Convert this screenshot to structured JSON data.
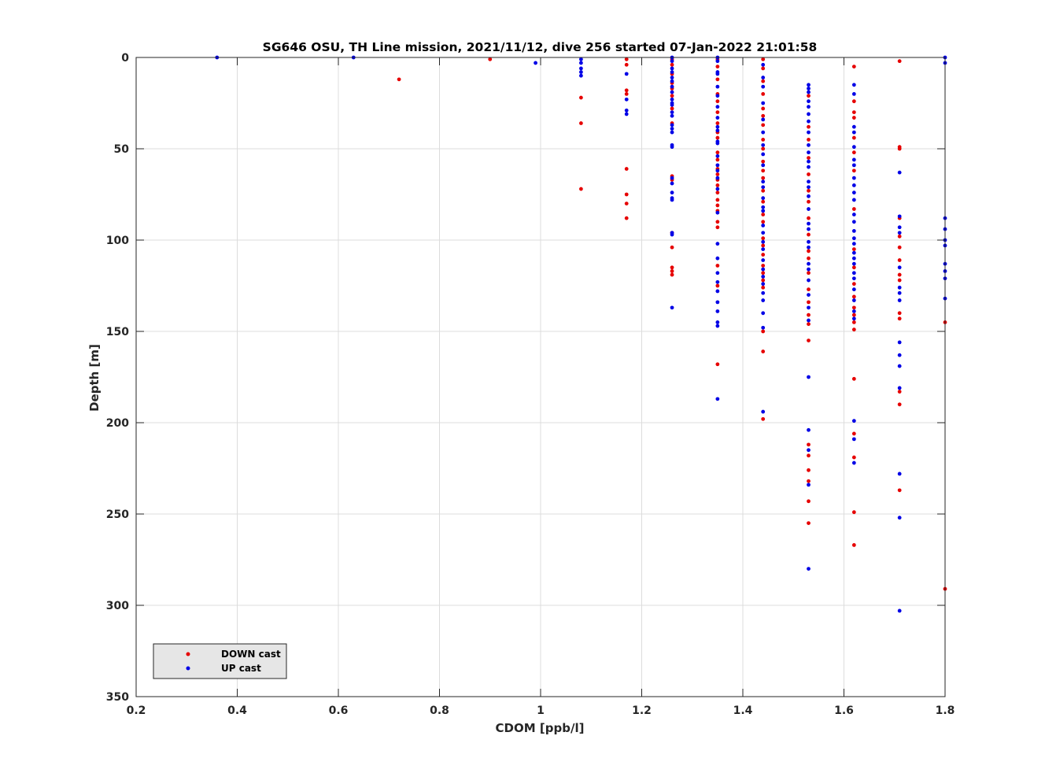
{
  "chart_data": {
    "type": "scatter",
    "title": "SG646 OSU, TH Line mission, 2021/11/12, dive 256 started 07-Jan-2022 21:01:58",
    "xlabel": "CDOM [ppb/l]",
    "ylabel": "Depth [m]",
    "xlim": [
      0.2,
      1.8
    ],
    "ylim": [
      0,
      350
    ],
    "y_reversed": true,
    "x_ticks": [
      0.2,
      0.4,
      0.6,
      0.8,
      1,
      1.2,
      1.4,
      1.6,
      1.8
    ],
    "x_tick_labels": [
      "0.2",
      "0.4",
      "0.6",
      "0.8",
      "1",
      "1.2",
      "1.4",
      "1.6",
      "1.8"
    ],
    "y_ticks": [
      0,
      50,
      100,
      150,
      200,
      250,
      300,
      350
    ],
    "y_tick_labels": [
      "0",
      "50",
      "100",
      "150",
      "200",
      "250",
      "300",
      "350"
    ],
    "grid": true,
    "legend_position": "bottom-left",
    "series": [
      {
        "name": "DOWN cast",
        "color": "#e60000",
        "points": [
          [
            0.72,
            12
          ],
          [
            0.9,
            1
          ],
          [
            1.08,
            22
          ],
          [
            1.08,
            36
          ],
          [
            1.08,
            72
          ],
          [
            1.17,
            1
          ],
          [
            1.17,
            4
          ],
          [
            1.17,
            18
          ],
          [
            1.17,
            20
          ],
          [
            1.17,
            61
          ],
          [
            1.17,
            75
          ],
          [
            1.17,
            80
          ],
          [
            1.17,
            88
          ],
          [
            1.26,
            1
          ],
          [
            1.26,
            4
          ],
          [
            1.26,
            9
          ],
          [
            1.26,
            14
          ],
          [
            1.26,
            17
          ],
          [
            1.26,
            21
          ],
          [
            1.26,
            28
          ],
          [
            1.26,
            36
          ],
          [
            1.26,
            65
          ],
          [
            1.26,
            67
          ],
          [
            1.26,
            96
          ],
          [
            1.26,
            104
          ],
          [
            1.26,
            115
          ],
          [
            1.26,
            117
          ],
          [
            1.26,
            119
          ],
          [
            1.35,
            1
          ],
          [
            1.35,
            5
          ],
          [
            1.35,
            12
          ],
          [
            1.35,
            20
          ],
          [
            1.35,
            24
          ],
          [
            1.35,
            30
          ],
          [
            1.35,
            36
          ],
          [
            1.35,
            41
          ],
          [
            1.35,
            44
          ],
          [
            1.35,
            52
          ],
          [
            1.35,
            56
          ],
          [
            1.35,
            61
          ],
          [
            1.35,
            64
          ],
          [
            1.35,
            67
          ],
          [
            1.35,
            70
          ],
          [
            1.35,
            74
          ],
          [
            1.35,
            78
          ],
          [
            1.35,
            81
          ],
          [
            1.35,
            84
          ],
          [
            1.35,
            90
          ],
          [
            1.35,
            93
          ],
          [
            1.35,
            114
          ],
          [
            1.35,
            125
          ],
          [
            1.35,
            168
          ],
          [
            1.44,
            1
          ],
          [
            1.44,
            6
          ],
          [
            1.44,
            13
          ],
          [
            1.44,
            20
          ],
          [
            1.44,
            28
          ],
          [
            1.44,
            32
          ],
          [
            1.44,
            37
          ],
          [
            1.44,
            45
          ],
          [
            1.44,
            50
          ],
          [
            1.44,
            57
          ],
          [
            1.44,
            62
          ],
          [
            1.44,
            66
          ],
          [
            1.44,
            73
          ],
          [
            1.44,
            79
          ],
          [
            1.44,
            86
          ],
          [
            1.44,
            90
          ],
          [
            1.44,
            99
          ],
          [
            1.44,
            103
          ],
          [
            1.44,
            108
          ],
          [
            1.44,
            114
          ],
          [
            1.44,
            118
          ],
          [
            1.44,
            122
          ],
          [
            1.44,
            126
          ],
          [
            1.44,
            150
          ],
          [
            1.44,
            161
          ],
          [
            1.44,
            198
          ],
          [
            1.53,
            21
          ],
          [
            1.53,
            38
          ],
          [
            1.53,
            45
          ],
          [
            1.53,
            55
          ],
          [
            1.53,
            64
          ],
          [
            1.53,
            73
          ],
          [
            1.53,
            79
          ],
          [
            1.53,
            88
          ],
          [
            1.53,
            97
          ],
          [
            1.53,
            106
          ],
          [
            1.53,
            110
          ],
          [
            1.53,
            118
          ],
          [
            1.53,
            127
          ],
          [
            1.53,
            134
          ],
          [
            1.53,
            141
          ],
          [
            1.53,
            146
          ],
          [
            1.53,
            155
          ],
          [
            1.53,
            212
          ],
          [
            1.53,
            218
          ],
          [
            1.53,
            226
          ],
          [
            1.53,
            232
          ],
          [
            1.53,
            243
          ],
          [
            1.53,
            255
          ],
          [
            1.62,
            5
          ],
          [
            1.62,
            24
          ],
          [
            1.62,
            30
          ],
          [
            1.62,
            33
          ],
          [
            1.62,
            44
          ],
          [
            1.62,
            52
          ],
          [
            1.62,
            62
          ],
          [
            1.62,
            83
          ],
          [
            1.62,
            105
          ],
          [
            1.62,
            115
          ],
          [
            1.62,
            124
          ],
          [
            1.62,
            131
          ],
          [
            1.62,
            137
          ],
          [
            1.62,
            141
          ],
          [
            1.62,
            145
          ],
          [
            1.62,
            149
          ],
          [
            1.62,
            176
          ],
          [
            1.62,
            206
          ],
          [
            1.62,
            219
          ],
          [
            1.62,
            249
          ],
          [
            1.62,
            267
          ],
          [
            1.71,
            2
          ],
          [
            1.71,
            49
          ],
          [
            1.71,
            50
          ],
          [
            1.71,
            88
          ],
          [
            1.71,
            98
          ],
          [
            1.71,
            104
          ],
          [
            1.71,
            111
          ],
          [
            1.71,
            119
          ],
          [
            1.71,
            122
          ],
          [
            1.71,
            140
          ],
          [
            1.71,
            143
          ],
          [
            1.71,
            183
          ],
          [
            1.71,
            190
          ],
          [
            1.71,
            237
          ],
          [
            1.8,
            145
          ],
          [
            1.8,
            291
          ]
        ]
      },
      {
        "name": "UP cast",
        "color": "#0000e6",
        "points": [
          [
            0.36,
            0
          ],
          [
            0.63,
            0
          ],
          [
            0.99,
            3
          ],
          [
            1.08,
            1
          ],
          [
            1.08,
            3
          ],
          [
            1.08,
            6
          ],
          [
            1.08,
            8
          ],
          [
            1.08,
            10
          ],
          [
            1.17,
            9
          ],
          [
            1.17,
            23
          ],
          [
            1.17,
            29
          ],
          [
            1.17,
            31
          ],
          [
            1.26,
            0
          ],
          [
            1.26,
            2
          ],
          [
            1.26,
            6
          ],
          [
            1.26,
            8
          ],
          [
            1.26,
            11
          ],
          [
            1.26,
            13
          ],
          [
            1.26,
            16
          ],
          [
            1.26,
            19
          ],
          [
            1.26,
            23
          ],
          [
            1.26,
            25
          ],
          [
            1.26,
            26
          ],
          [
            1.26,
            30
          ],
          [
            1.26,
            32
          ],
          [
            1.26,
            37
          ],
          [
            1.26,
            39
          ],
          [
            1.26,
            41
          ],
          [
            1.26,
            48
          ],
          [
            1.26,
            49
          ],
          [
            1.26,
            66
          ],
          [
            1.26,
            69
          ],
          [
            1.26,
            74
          ],
          [
            1.26,
            77
          ],
          [
            1.26,
            78
          ],
          [
            1.26,
            96
          ],
          [
            1.26,
            97
          ],
          [
            1.26,
            137
          ],
          [
            1.35,
            0
          ],
          [
            1.35,
            2
          ],
          [
            1.35,
            8
          ],
          [
            1.35,
            9
          ],
          [
            1.35,
            16
          ],
          [
            1.35,
            21
          ],
          [
            1.35,
            27
          ],
          [
            1.35,
            33
          ],
          [
            1.35,
            38
          ],
          [
            1.35,
            40
          ],
          [
            1.35,
            46
          ],
          [
            1.35,
            47
          ],
          [
            1.35,
            54
          ],
          [
            1.35,
            59
          ],
          [
            1.35,
            62
          ],
          [
            1.35,
            66
          ],
          [
            1.35,
            72
          ],
          [
            1.35,
            85
          ],
          [
            1.35,
            102
          ],
          [
            1.35,
            110
          ],
          [
            1.35,
            118
          ],
          [
            1.35,
            123
          ],
          [
            1.35,
            128
          ],
          [
            1.35,
            134
          ],
          [
            1.35,
            139
          ],
          [
            1.35,
            145
          ],
          [
            1.35,
            147
          ],
          [
            1.35,
            187
          ],
          [
            1.44,
            4
          ],
          [
            1.44,
            11
          ],
          [
            1.44,
            16
          ],
          [
            1.44,
            25
          ],
          [
            1.44,
            34
          ],
          [
            1.44,
            41
          ],
          [
            1.44,
            48
          ],
          [
            1.44,
            53
          ],
          [
            1.44,
            59
          ],
          [
            1.44,
            68
          ],
          [
            1.44,
            71
          ],
          [
            1.44,
            77
          ],
          [
            1.44,
            82
          ],
          [
            1.44,
            84
          ],
          [
            1.44,
            92
          ],
          [
            1.44,
            96
          ],
          [
            1.44,
            101
          ],
          [
            1.44,
            105
          ],
          [
            1.44,
            111
          ],
          [
            1.44,
            116
          ],
          [
            1.44,
            120
          ],
          [
            1.44,
            124
          ],
          [
            1.44,
            129
          ],
          [
            1.44,
            133
          ],
          [
            1.44,
            140
          ],
          [
            1.44,
            148
          ],
          [
            1.44,
            194
          ],
          [
            1.53,
            15
          ],
          [
            1.53,
            17
          ],
          [
            1.53,
            19
          ],
          [
            1.53,
            24
          ],
          [
            1.53,
            27
          ],
          [
            1.53,
            31
          ],
          [
            1.53,
            35
          ],
          [
            1.53,
            41
          ],
          [
            1.53,
            48
          ],
          [
            1.53,
            52
          ],
          [
            1.53,
            57
          ],
          [
            1.53,
            60
          ],
          [
            1.53,
            68
          ],
          [
            1.53,
            71
          ],
          [
            1.53,
            76
          ],
          [
            1.53,
            83
          ],
          [
            1.53,
            91
          ],
          [
            1.53,
            94
          ],
          [
            1.53,
            101
          ],
          [
            1.53,
            104
          ],
          [
            1.53,
            113
          ],
          [
            1.53,
            116
          ],
          [
            1.53,
            122
          ],
          [
            1.53,
            130
          ],
          [
            1.53,
            137
          ],
          [
            1.53,
            144
          ],
          [
            1.53,
            175
          ],
          [
            1.53,
            204
          ],
          [
            1.53,
            215
          ],
          [
            1.53,
            234
          ],
          [
            1.53,
            280
          ],
          [
            1.62,
            15
          ],
          [
            1.62,
            20
          ],
          [
            1.62,
            38
          ],
          [
            1.62,
            41
          ],
          [
            1.62,
            49
          ],
          [
            1.62,
            56
          ],
          [
            1.62,
            59
          ],
          [
            1.62,
            66
          ],
          [
            1.62,
            70
          ],
          [
            1.62,
            74
          ],
          [
            1.62,
            78
          ],
          [
            1.62,
            86
          ],
          [
            1.62,
            90
          ],
          [
            1.62,
            95
          ],
          [
            1.62,
            99
          ],
          [
            1.62,
            102
          ],
          [
            1.62,
            107
          ],
          [
            1.62,
            110
          ],
          [
            1.62,
            113
          ],
          [
            1.62,
            118
          ],
          [
            1.62,
            121
          ],
          [
            1.62,
            127
          ],
          [
            1.62,
            133
          ],
          [
            1.62,
            139
          ],
          [
            1.62,
            143
          ],
          [
            1.62,
            199
          ],
          [
            1.62,
            209
          ],
          [
            1.62,
            222
          ],
          [
            1.71,
            63
          ],
          [
            1.71,
            87
          ],
          [
            1.71,
            93
          ],
          [
            1.71,
            96
          ],
          [
            1.71,
            115
          ],
          [
            1.71,
            126
          ],
          [
            1.71,
            129
          ],
          [
            1.71,
            133
          ],
          [
            1.71,
            156
          ],
          [
            1.71,
            163
          ],
          [
            1.71,
            169
          ],
          [
            1.71,
            181
          ],
          [
            1.71,
            228
          ],
          [
            1.71,
            252
          ],
          [
            1.71,
            303
          ],
          [
            1.8,
            0
          ],
          [
            1.8,
            3
          ],
          [
            1.8,
            88
          ],
          [
            1.8,
            94
          ],
          [
            1.8,
            100
          ],
          [
            1.8,
            103
          ],
          [
            1.8,
            113
          ],
          [
            1.8,
            117
          ],
          [
            1.8,
            121
          ],
          [
            1.8,
            132
          ]
        ]
      }
    ]
  }
}
